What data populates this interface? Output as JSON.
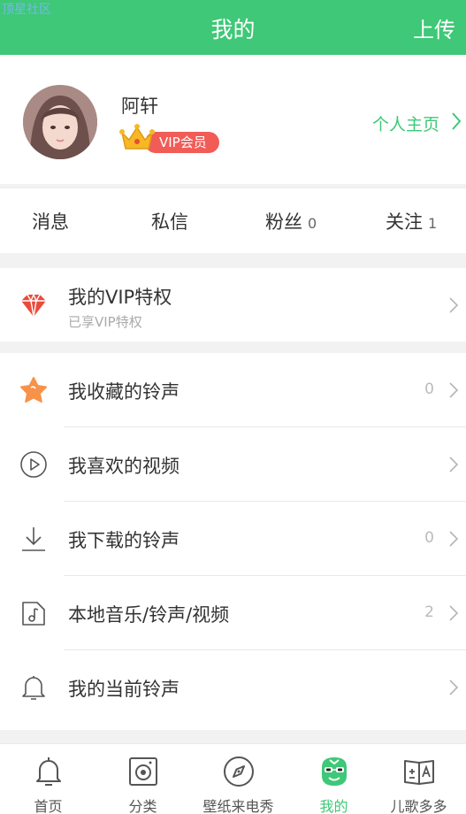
{
  "watermark": "顶星社区",
  "header": {
    "title": "我的",
    "upload_label": "上传"
  },
  "profile": {
    "username": "阿轩",
    "vip_label": "VIP会员",
    "homepage_label": "个人主页"
  },
  "stats": [
    {
      "label": "消息",
      "count": ""
    },
    {
      "label": "私信",
      "count": ""
    },
    {
      "label": "粉丝",
      "count": "0"
    },
    {
      "label": "关注",
      "count": "1"
    }
  ],
  "vip": {
    "title": "我的VIP特权",
    "subtitle": "已享VIP特权"
  },
  "menu": [
    {
      "label": "我收藏的铃声",
      "count": "0",
      "icon": "star-icon"
    },
    {
      "label": "我喜欢的视频",
      "count": "",
      "icon": "play-circle-icon"
    },
    {
      "label": "我下载的铃声",
      "count": "0",
      "icon": "download-icon"
    },
    {
      "label": "本地音乐/铃声/视频",
      "count": "2",
      "icon": "music-file-icon"
    },
    {
      "label": "我的当前铃声",
      "count": "",
      "icon": "bell-icon"
    }
  ],
  "tabs": [
    {
      "label": "首页",
      "icon": "home-bell-icon"
    },
    {
      "label": "分类",
      "icon": "category-icon"
    },
    {
      "label": "壁纸来电秀",
      "icon": "compass-icon"
    },
    {
      "label": "我的",
      "icon": "profile-face-icon",
      "active": true
    },
    {
      "label": "儿歌多多",
      "icon": "book-icon"
    }
  ],
  "colors": {
    "brand_green": "#3ec877",
    "vip_red": "#f15c57",
    "star_orange": "#f7924a",
    "diamond_red": "#e94b3c"
  }
}
